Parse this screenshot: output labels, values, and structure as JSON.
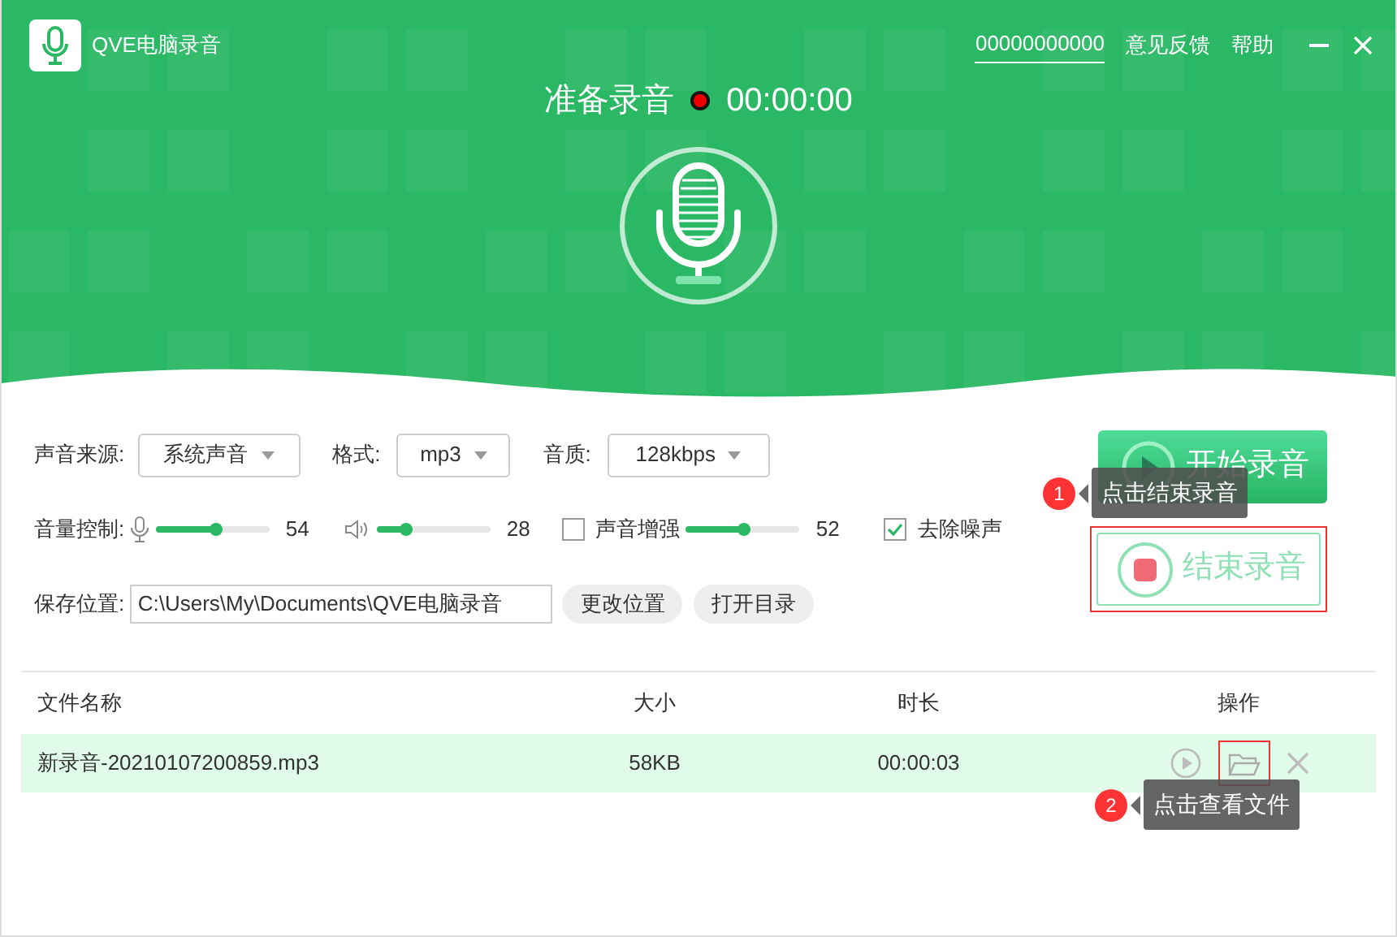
{
  "window": {
    "title": "QVE电脑录音"
  },
  "account": "00000000000",
  "menu": [
    "意见反馈",
    "帮助"
  ],
  "status": {
    "label": "准备录音",
    "time": "00:00:00"
  },
  "dropdowns": [
    {
      "label": "声音来源:",
      "value": "系统声音",
      "kind": "wide"
    },
    {
      "label": "格式:",
      "value": "mp3",
      "kind": "narrow"
    },
    {
      "label": "音质:",
      "value": "128kbps",
      "kind": "wide"
    }
  ],
  "volume": {
    "label": "音量控制:",
    "sliders": [
      {
        "kind": "mic",
        "level": 0.54,
        "reading": "54"
      },
      {
        "kind": "speaker",
        "level": 0.28,
        "reading": "28"
      },
      {
        "kind": "enhance",
        "label": "声音增强",
        "checked": false,
        "level": 0.52,
        "reading": "52"
      }
    ],
    "denoise": {
      "label": "去除噪声",
      "checked": true
    }
  },
  "save": {
    "label": "保存位置:",
    "value": "C:\\Users\\My\\Documents\\QVE电脑录音",
    "buttons": [
      "更改位置",
      "打开目录"
    ]
  },
  "actions": [
    {
      "kind": "start",
      "label": "开始录音",
      "highlighted": false
    },
    {
      "kind": "stop",
      "label": "结束录音",
      "highlighted": true
    }
  ],
  "table": {
    "columns": [
      "文件名称",
      "大小",
      "时长",
      "操作"
    ],
    "rows": [
      {
        "name": "新录音-20210107200859.mp3",
        "size": "58KB",
        "duration": "00:00:03",
        "selected": true,
        "folder_highlighted": true
      }
    ]
  },
  "tips": [
    {
      "number": "1",
      "text": "点击结束录音"
    },
    {
      "number": "2",
      "text": "点击查看文件"
    }
  ]
}
